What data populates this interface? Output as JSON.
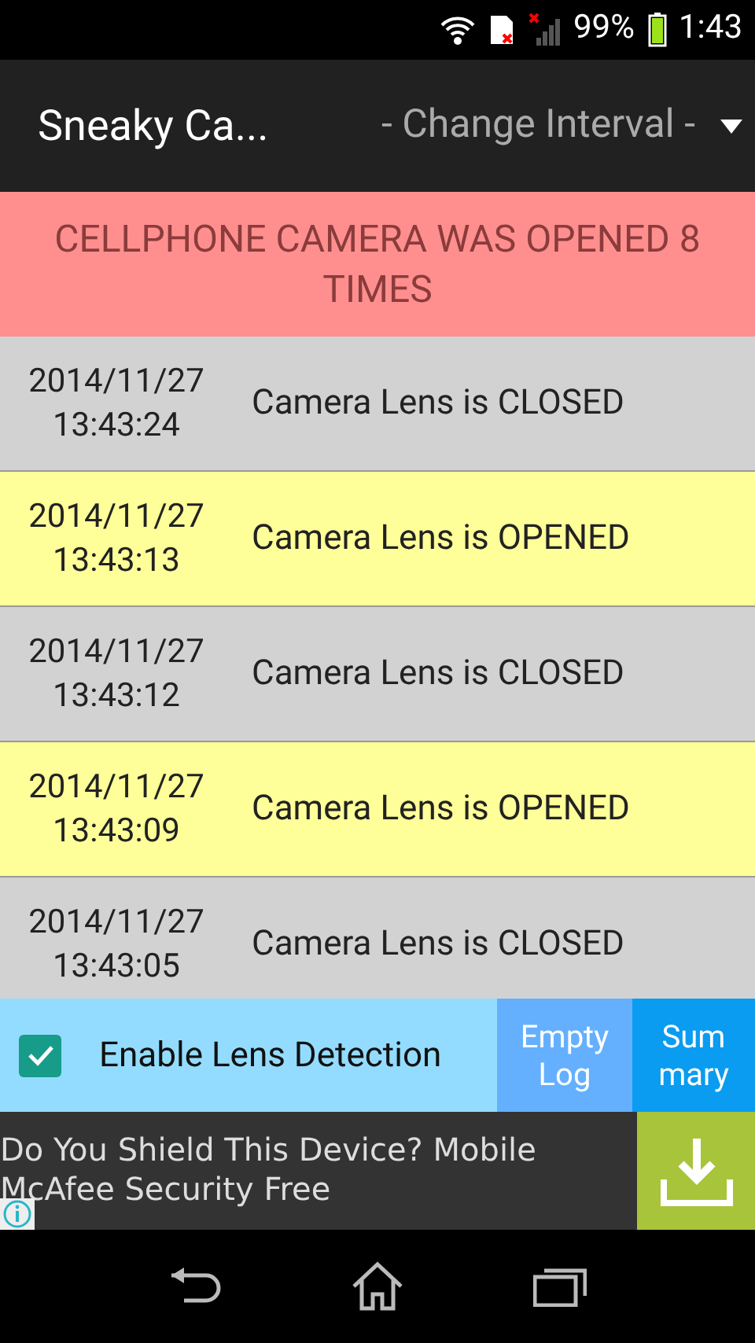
{
  "status_bar": {
    "battery": "99%",
    "time": "1:43"
  },
  "app_bar": {
    "title": "Sneaky Ca...",
    "interval_dropdown": "- Change Interval -"
  },
  "banner": "CELLPHONE CAMERA WAS OPENED 8 TIMES",
  "log": [
    {
      "kind": "closed",
      "date": "2014/11/27",
      "time": "13:43:24",
      "message": "Camera Lens is CLOSED"
    },
    {
      "kind": "opened",
      "date": "2014/11/27",
      "time": "13:43:13",
      "message": "Camera Lens is OPENED"
    },
    {
      "kind": "closed",
      "date": "2014/11/27",
      "time": "13:43:12",
      "message": "Camera Lens is CLOSED"
    },
    {
      "kind": "opened",
      "date": "2014/11/27",
      "time": "13:43:09",
      "message": "Camera Lens is OPENED"
    },
    {
      "kind": "closed",
      "date": "2014/11/27",
      "time": "13:43:05",
      "message": "Camera Lens is CLOSED"
    }
  ],
  "controls": {
    "lens_detection": {
      "label": "Enable Lens Detection",
      "checked": true
    },
    "empty_log": "Empty Log",
    "summary": "Summary"
  },
  "ad": {
    "text": "Do You Shield This Device? Mobile McAfee Security Free"
  }
}
